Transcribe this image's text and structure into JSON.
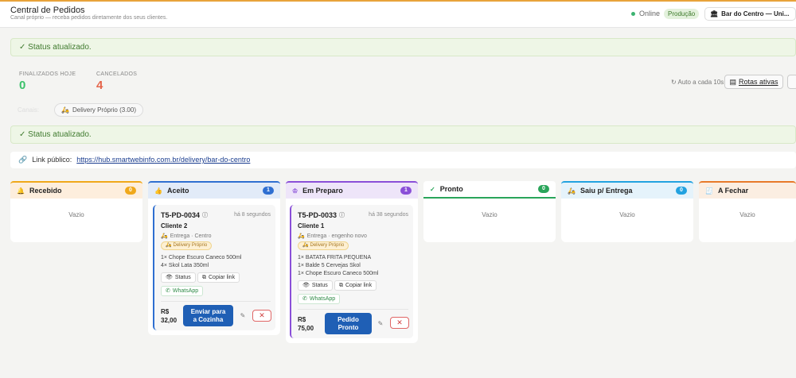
{
  "header": {
    "title": "Central de Pedidos",
    "subtitle": "Canal próprio — receba pedidos diretamente dos seus clientes.",
    "status": "Online",
    "env": "Produção",
    "store": "Bar do Centro — Uni...",
    "accent": "#e8a33a"
  },
  "alerts": {
    "top": "✓ Status atualizado.",
    "middle": "✓ Status atualizado."
  },
  "stats": [
    {
      "label": "FINALIZADOS HOJE",
      "value": "0",
      "color": "#3cc26b"
    },
    {
      "label": "CANCELADOS",
      "value": "4",
      "color": "#e5654b"
    }
  ],
  "toolbar": {
    "auto": "Auto a cada 10s",
    "rotas": "Rotas ativas"
  },
  "channels": {
    "label": "Canais:",
    "chip": "Delivery Próprio (3.00)"
  },
  "public_link": {
    "label": "Link público:",
    "url": "https://hub.smartwebinfo.com.br/delivery/bar-do-centro"
  },
  "columns": [
    {
      "title": "Recebido",
      "count": "0",
      "color": "#f0a81a",
      "icon": "bell-icon",
      "glyph": "🔔",
      "empty": "Vazio"
    },
    {
      "title": "Aceito",
      "count": "1",
      "color": "#2f6fd1",
      "icon": "thumbs-up-icon",
      "glyph": "👍",
      "empty": ""
    },
    {
      "title": "Em Preparo",
      "count": "1",
      "color": "#8a4fd8",
      "icon": "chef-hat-icon",
      "glyph": "♔",
      "empty": ""
    },
    {
      "title": "Pronto",
      "count": "0",
      "color": "#2aa55a",
      "icon": "check-circle-icon",
      "glyph": "✓",
      "empty": "Vazio"
    },
    {
      "title": "Saiu p/ Entrega",
      "count": "0",
      "color": "#22a2e0",
      "icon": "scooter-icon",
      "glyph": "🛵",
      "empty": "Vazio"
    },
    {
      "title": "A Fechar",
      "count": "",
      "color": "#e87a2a",
      "icon": "receipt-icon",
      "glyph": "🧾",
      "empty": "Vazio"
    }
  ],
  "orders": [
    {
      "code": "T5-PD-0034",
      "time": "há 8 segundos",
      "client": "Cliente 2",
      "type": "Entrega · Centro",
      "tag": "Delivery Próprio",
      "items": [
        "1× Chope Escuro Caneco 500ml",
        "4× Skol Lata 350ml"
      ],
      "status_btn": "Status",
      "copy_btn": "Copiar link",
      "wa_btn": "WhatsApp",
      "price_cur": "R$",
      "price_val": "32,00",
      "action": [
        "Enviar para",
        "a Cozinha"
      ]
    },
    {
      "code": "T5-PD-0033",
      "time": "há 38 segundos",
      "client": "Cliente 1",
      "type": "Entrega · engenho novo",
      "tag": "Delivery Próprio",
      "items": [
        "1× BATATA FRITA PEQUENA",
        "1× Balde 5 Cervejas Skol",
        "1× Chope Escuro Caneco 500ml"
      ],
      "status_btn": "Status",
      "copy_btn": "Copiar link",
      "wa_btn": "WhatsApp",
      "price_cur": "R$",
      "price_val": "75,00",
      "action": [
        "Pedido",
        "Pronto"
      ]
    }
  ]
}
